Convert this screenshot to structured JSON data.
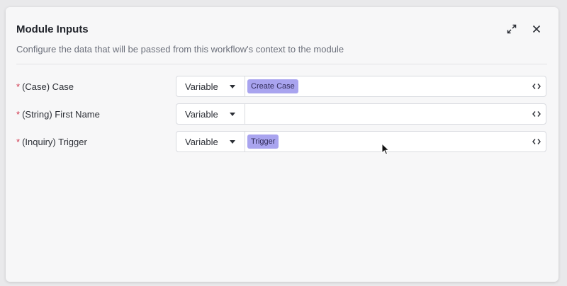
{
  "dialog": {
    "title": "Module Inputs",
    "subtitle": "Configure the data that will be passed from this workflow's context to the module",
    "expand_icon": "expand-icon",
    "close_icon": "close-icon"
  },
  "inputs": [
    {
      "required_mark": "*",
      "label": "(Case) Case",
      "type_select": "Variable",
      "chip": "Create Case"
    },
    {
      "required_mark": "*",
      "label": "(String) First Name",
      "type_select": "Variable",
      "chip": ""
    },
    {
      "required_mark": "*",
      "label": "(Inquiry) Trigger",
      "type_select": "Variable",
      "chip": "Trigger"
    }
  ],
  "colors": {
    "chip_bg": "#a9a4ef",
    "required": "#d0374d"
  }
}
